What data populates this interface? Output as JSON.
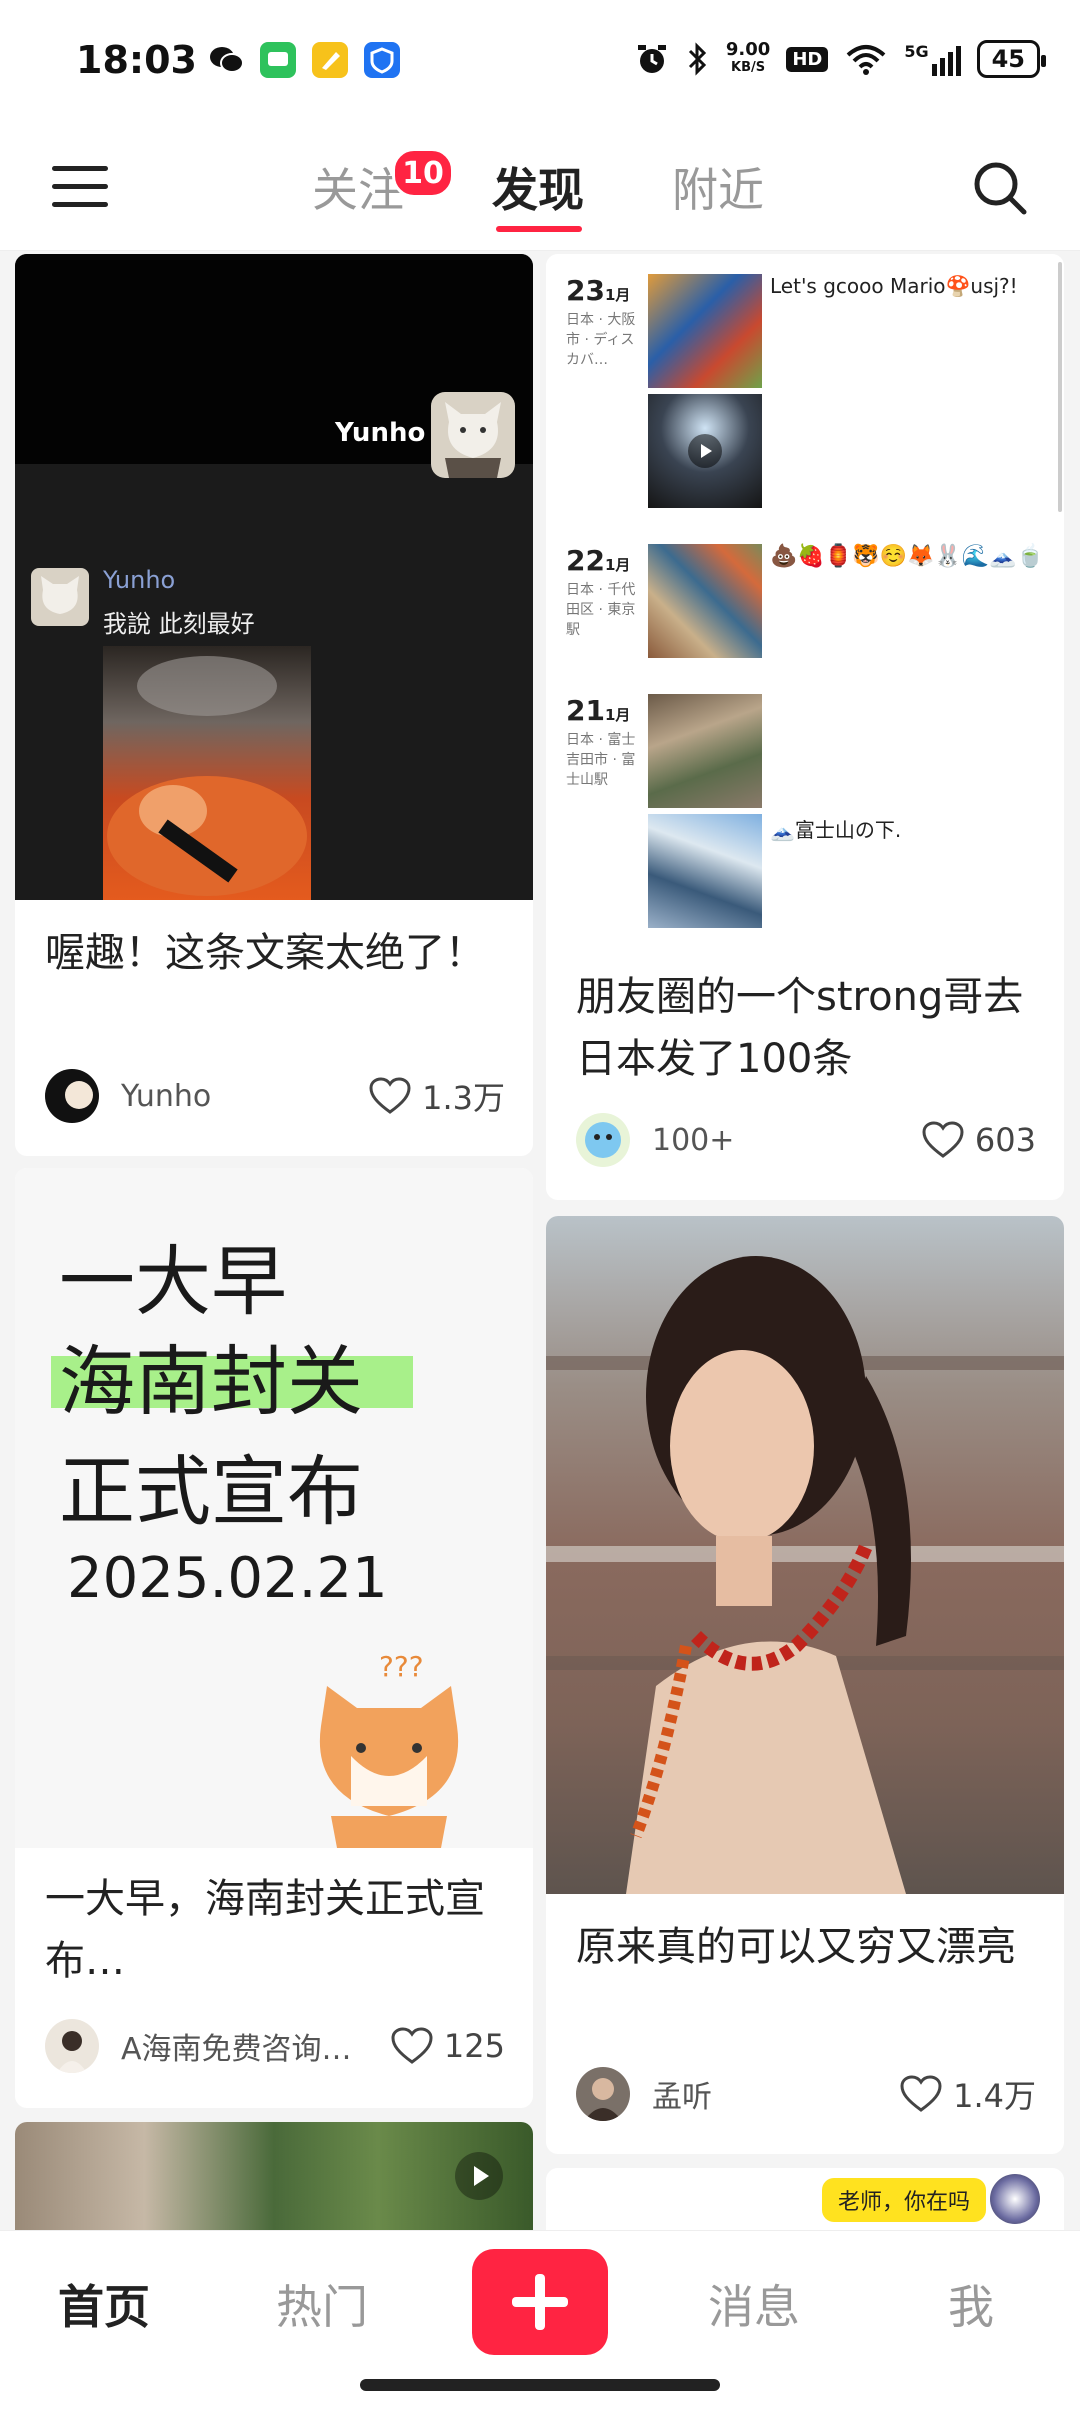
{
  "status_bar": {
    "time": "18:03",
    "net_speed_value": "9.00",
    "net_speed_unit": "KB/S",
    "hd": "HD",
    "network": "5G",
    "battery": "45"
  },
  "top_nav": {
    "tabs": [
      "关注",
      "发现",
      "附近"
    ],
    "follow_badge": "10",
    "active_tab": "发现"
  },
  "feed": {
    "card1": {
      "overlay_name": "Yunho",
      "chat_name": "Yunho",
      "chat_text": "我說 此刻最好",
      "title": "喔趣！这条文案太绝了！",
      "author": "Yunho",
      "likes": "1.3万"
    },
    "card2": {
      "entries": [
        {
          "day": "23",
          "month": "1月",
          "location": "日本 · 大阪市 · ディスカバ…",
          "caption": "Let's gcooo Mario🍄usj?!"
        },
        {
          "day": "22",
          "month": "1月",
          "location": "日本 · 千代田区 · 東京駅",
          "caption": "💩🍓🏮🐯☺️🦊🐰🌊🗻🍵"
        },
        {
          "day": "21",
          "month": "1月",
          "location": "日本 · 富士吉田市 · 富士山駅",
          "caption": "🗻富士山の下."
        }
      ],
      "title": "朋友圈的一个strong哥去日本发了100条",
      "author": "100+",
      "likes": "603"
    },
    "card3": {
      "line1": "一大早",
      "line2": "海南封关",
      "line3": "正式宣布",
      "date": "2025.02.21",
      "title": "一大早，海南封关正式宣布…",
      "author": "A海南免费咨询…",
      "likes": "125"
    },
    "card4": {
      "title": "原来真的可以又穷又漂亮",
      "author": "孟听",
      "likes": "1.4万"
    },
    "card6": {
      "bubble": "老师，你在吗"
    }
  },
  "bottom_nav": {
    "items": [
      "首页",
      "热门",
      "消息",
      "我"
    ],
    "active": "首页"
  },
  "colors": {
    "accent": "#ff2442",
    "highlight": "#a8f08a",
    "bubble": "#ffe21f"
  }
}
